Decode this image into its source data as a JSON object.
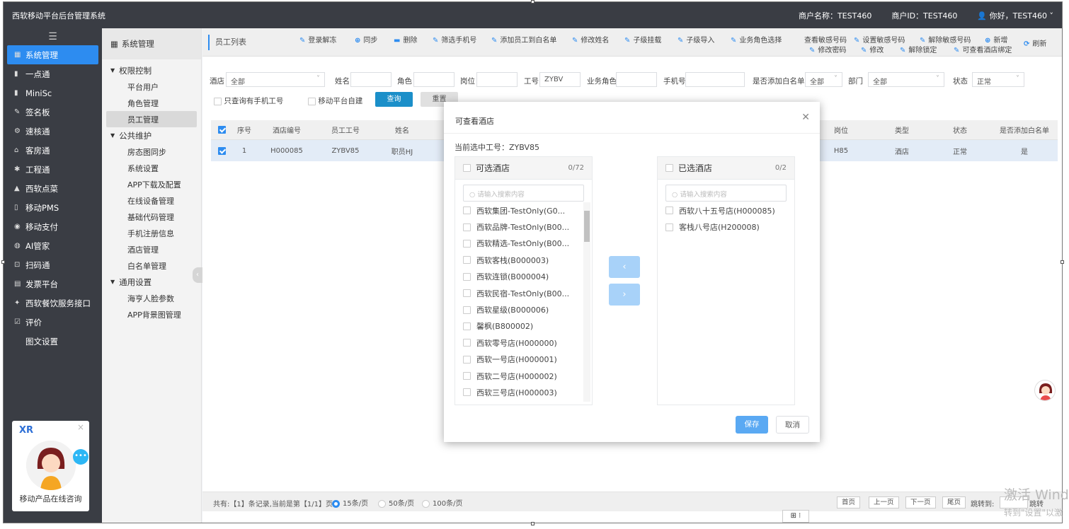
{
  "app": {
    "title": "西软移动平台后台管理系统",
    "merchant_name": "商户名称：TEST460",
    "merchant_id": "商户ID：TEST460",
    "user": "你好，TEST460"
  },
  "sidebar": {
    "items": [
      {
        "label": "系统管理",
        "icon": "grid-icon"
      },
      {
        "label": "一点通",
        "icon": "bar-chart-icon"
      },
      {
        "label": "MiniSc",
        "icon": "bar-chart-icon"
      },
      {
        "label": "签名板",
        "icon": "pen-icon"
      },
      {
        "label": "速核通",
        "icon": "cog-icon"
      },
      {
        "label": "客房通",
        "icon": "home-icon"
      },
      {
        "label": "工程通",
        "icon": "wrench-icon"
      },
      {
        "label": "西软点菜",
        "icon": "cloud-icon"
      },
      {
        "label": "移动PMS",
        "icon": "mobile-icon"
      },
      {
        "label": "移动支付",
        "icon": "pay-icon"
      },
      {
        "label": "AI管家",
        "icon": "ai-icon"
      },
      {
        "label": "扫码通",
        "icon": "scan-icon"
      },
      {
        "label": "发票平台",
        "icon": "invoice-icon"
      },
      {
        "label": "西软餐饮服务接口",
        "icon": "star-icon"
      },
      {
        "label": "评价",
        "icon": "edit-icon"
      },
      {
        "label": "图文设置",
        "icon": ""
      }
    ]
  },
  "chat_widget": {
    "logo": "XR",
    "label": "移动产品在线咨询"
  },
  "submenu": {
    "header": "系统管理",
    "groups": [
      {
        "label": "权限控制",
        "items": [
          "平台用户",
          "角色管理",
          "员工管理"
        ]
      },
      {
        "label": "公共维护",
        "items": [
          "房态图同步",
          "系统设置",
          "APP下载及配置",
          "在线设备管理",
          "基础代码管理",
          "手机注册信息",
          "酒店管理",
          "白名单管理"
        ]
      },
      {
        "label": "通用设置",
        "items": [
          "海亨人脸参数",
          "APP背景图管理"
        ]
      }
    ]
  },
  "toolbar": {
    "crumb": "员工列表",
    "row1": [
      "登录解冻",
      "同步",
      "删除",
      "筛选手机号",
      "添加员工到白名单",
      "修改姓名",
      "子级挂载",
      "子级导入",
      "业务角色选择",
      "查看敏感号码",
      "设置敏感号码",
      "解除敏感号码",
      "新增"
    ],
    "row2": [
      "修改密码",
      "修改",
      "解除锁定",
      "可查看酒店绑定"
    ],
    "refresh": "刷新"
  },
  "filters": {
    "hotel_label": "酒店",
    "hotel_value": "全部",
    "name_label": "姓名",
    "role_label": "角色",
    "post_label": "岗位",
    "empno_label": "工号",
    "empno_value": "ZYBV",
    "bizrole_label": "业务角色",
    "phone_label": "手机号",
    "whitelist_label": "是否添加白名单",
    "whitelist_value": "全部",
    "dept_label": "部门",
    "dept_value": "全部",
    "status_label": "状态",
    "status_value": "正常",
    "only_phone": "只查询有手机工号",
    "self_built": "移动平台自建",
    "query": "查询",
    "reset": "重置"
  },
  "table": {
    "headers": [
      "序号",
      "酒店编号",
      "员工工号",
      "姓名",
      "岗位",
      "类型",
      "状态",
      "是否添加白名单"
    ],
    "row": {
      "no": "1",
      "hotel": "H000085",
      "empno": "ZYBV85",
      "name": "职员HJ",
      "post": "H85",
      "type": "酒店",
      "status": "正常",
      "whitelist": "是"
    }
  },
  "footer": {
    "summary": "共有:【1】条记录,当前是第【1/1】页",
    "sizes": [
      "15条/页",
      "50条/页",
      "100条/页"
    ],
    "first": "首页",
    "prev": "上一页",
    "next": "下一页",
    "last": "尾页",
    "jump": "跳转到:",
    "go": "跳转"
  },
  "modal": {
    "title": "可查看酒店",
    "current": "当前选中工号：ZYBV85",
    "left": {
      "title": "可选酒店",
      "count": "0/72",
      "placeholder": "请输入搜索内容",
      "items": [
        "西软集团-TestOnly(G0...",
        "西软品牌-TestOnly(B00...",
        "西软精选-TestOnly(B00...",
        "西软客栈(B000003)",
        "西软连锁(B000004)",
        "西软民宿-TestOnly(B00...",
        "西软星级(B000006)",
        "馨枫(B800002)",
        "西软零号店(H000000)",
        "西软一号店(H000001)",
        "西软二号店(H000002)",
        "西软三号店(H000003)"
      ]
    },
    "right": {
      "title": "已选酒店",
      "count": "0/2",
      "placeholder": "请输入搜索内容",
      "items": [
        "西软八十五号店(H000085)",
        "客栈八号店(H200008)"
      ]
    },
    "left_arrow": "‹",
    "right_arrow": "›",
    "save": "保存",
    "cancel": "取消"
  },
  "watermark": {
    "line1": "激活 Wind",
    "line2": "转到\"设置\"以激"
  },
  "colors": {
    "accent": "#2d8cf0",
    "sidebar_bg": "#3a3d44",
    "query_btn": "#1b8fc9",
    "save_btn": "#5aa9f3"
  }
}
